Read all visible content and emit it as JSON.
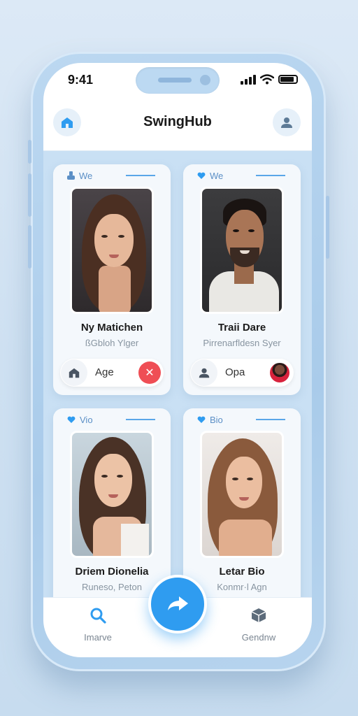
{
  "status_bar": {
    "time": "9:41"
  },
  "header": {
    "title": "SwingHub",
    "left_icon": "home-icon",
    "right_icon": "user-icon"
  },
  "cards": [
    {
      "tag": "We",
      "tag_icon": "pin-icon",
      "name": "Ny Matichen",
      "sub": "ßGbloh Ylger",
      "pill_label": "Age",
      "pill_icon": "home-icon",
      "pill_action": "close-icon"
    },
    {
      "tag": "We",
      "tag_icon": "heart-icon",
      "name": "Traii Dare",
      "sub": "Pirrenarfldesn Syer",
      "pill_label": "Opa",
      "pill_icon": "user-icon",
      "pill_action": "avatar"
    },
    {
      "tag": "Vio",
      "tag_icon": "heart-icon",
      "name": "Driem Dionelia",
      "sub": "Runeso, Peton"
    },
    {
      "tag": "Bio",
      "tag_icon": "heart-icon",
      "name": "Letar Bio",
      "sub": "Konmr·l Agn"
    }
  ],
  "tabbar": {
    "left_label": "Imarve",
    "left_icon": "search-icon",
    "center_icon": "share-arrow-icon",
    "right_label": "Gendnw",
    "right_icon": "box-icon"
  },
  "colors": {
    "accent": "#2f9cf0",
    "close": "#ef4e55",
    "tag": "#5b8fc6"
  }
}
